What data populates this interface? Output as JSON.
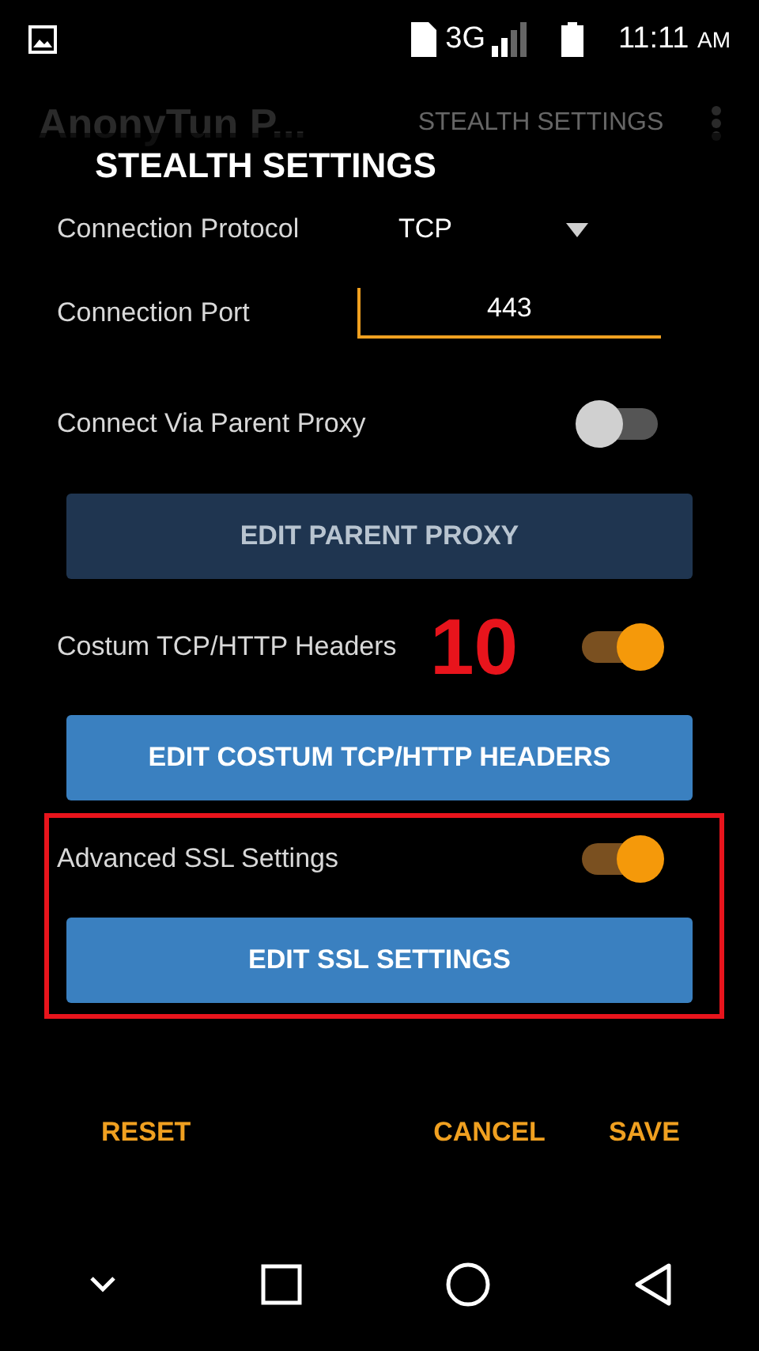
{
  "status_bar": {
    "network": "3G",
    "time": "11:11",
    "meridiem": "AM"
  },
  "app_bar": {
    "title": "AnonyTun P...",
    "tab": "STEALTH SETTINGS"
  },
  "dialog": {
    "title": "STEALTH SETTINGS",
    "items": [
      {
        "kind": "select",
        "label": "Connection Protocol",
        "value": "TCP"
      },
      {
        "kind": "input",
        "label": "Connection Port",
        "value": "443"
      },
      {
        "kind": "toggle",
        "label": "Connect Via Parent Proxy",
        "on": false
      },
      {
        "kind": "button",
        "label": "EDIT PARENT PROXY",
        "disabled": true
      },
      {
        "kind": "toggle",
        "label": "Costum TCP/HTTP Headers",
        "on": true
      },
      {
        "kind": "button",
        "label": "EDIT COSTUM TCP/HTTP HEADERS",
        "disabled": false
      },
      {
        "kind": "toggle",
        "label": "Advanced SSL Settings",
        "on": true
      },
      {
        "kind": "button",
        "label": "EDIT SSL SETTINGS",
        "disabled": false
      }
    ],
    "actions": [
      "RESET",
      "CANCEL",
      "SAVE"
    ]
  },
  "annotation": {
    "number": "10"
  }
}
